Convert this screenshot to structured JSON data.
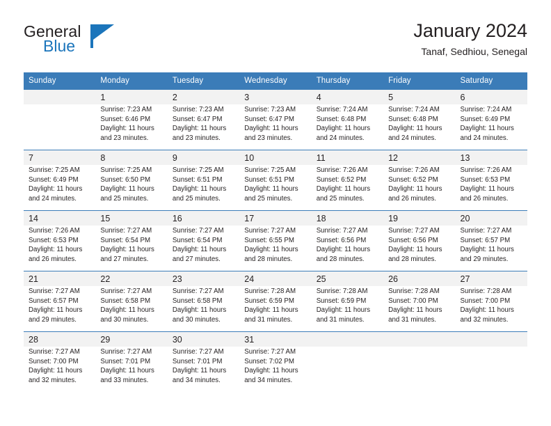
{
  "brand": {
    "name_part1": "General",
    "name_part2": "Blue",
    "flag_icon": "blue-flag-icon",
    "accent_color": "#1b75bb"
  },
  "header": {
    "title": "January 2024",
    "subtitle": "Tanaf, Sedhiou, Senegal"
  },
  "calendar": {
    "header_bg": "#3b7cb8",
    "daynum_bg": "#f2f2f2",
    "weekdays": [
      "Sunday",
      "Monday",
      "Tuesday",
      "Wednesday",
      "Thursday",
      "Friday",
      "Saturday"
    ],
    "weeks": [
      [
        {
          "day": "",
          "sunrise": "",
          "sunset": "",
          "daylight_1": "",
          "daylight_2": ""
        },
        {
          "day": "1",
          "sunrise": "Sunrise: 7:23 AM",
          "sunset": "Sunset: 6:46 PM",
          "daylight_1": "Daylight: 11 hours",
          "daylight_2": "and 23 minutes."
        },
        {
          "day": "2",
          "sunrise": "Sunrise: 7:23 AM",
          "sunset": "Sunset: 6:47 PM",
          "daylight_1": "Daylight: 11 hours",
          "daylight_2": "and 23 minutes."
        },
        {
          "day": "3",
          "sunrise": "Sunrise: 7:23 AM",
          "sunset": "Sunset: 6:47 PM",
          "daylight_1": "Daylight: 11 hours",
          "daylight_2": "and 23 minutes."
        },
        {
          "day": "4",
          "sunrise": "Sunrise: 7:24 AM",
          "sunset": "Sunset: 6:48 PM",
          "daylight_1": "Daylight: 11 hours",
          "daylight_2": "and 24 minutes."
        },
        {
          "day": "5",
          "sunrise": "Sunrise: 7:24 AM",
          "sunset": "Sunset: 6:48 PM",
          "daylight_1": "Daylight: 11 hours",
          "daylight_2": "and 24 minutes."
        },
        {
          "day": "6",
          "sunrise": "Sunrise: 7:24 AM",
          "sunset": "Sunset: 6:49 PM",
          "daylight_1": "Daylight: 11 hours",
          "daylight_2": "and 24 minutes."
        }
      ],
      [
        {
          "day": "7",
          "sunrise": "Sunrise: 7:25 AM",
          "sunset": "Sunset: 6:49 PM",
          "daylight_1": "Daylight: 11 hours",
          "daylight_2": "and 24 minutes."
        },
        {
          "day": "8",
          "sunrise": "Sunrise: 7:25 AM",
          "sunset": "Sunset: 6:50 PM",
          "daylight_1": "Daylight: 11 hours",
          "daylight_2": "and 25 minutes."
        },
        {
          "day": "9",
          "sunrise": "Sunrise: 7:25 AM",
          "sunset": "Sunset: 6:51 PM",
          "daylight_1": "Daylight: 11 hours",
          "daylight_2": "and 25 minutes."
        },
        {
          "day": "10",
          "sunrise": "Sunrise: 7:25 AM",
          "sunset": "Sunset: 6:51 PM",
          "daylight_1": "Daylight: 11 hours",
          "daylight_2": "and 25 minutes."
        },
        {
          "day": "11",
          "sunrise": "Sunrise: 7:26 AM",
          "sunset": "Sunset: 6:52 PM",
          "daylight_1": "Daylight: 11 hours",
          "daylight_2": "and 25 minutes."
        },
        {
          "day": "12",
          "sunrise": "Sunrise: 7:26 AM",
          "sunset": "Sunset: 6:52 PM",
          "daylight_1": "Daylight: 11 hours",
          "daylight_2": "and 26 minutes."
        },
        {
          "day": "13",
          "sunrise": "Sunrise: 7:26 AM",
          "sunset": "Sunset: 6:53 PM",
          "daylight_1": "Daylight: 11 hours",
          "daylight_2": "and 26 minutes."
        }
      ],
      [
        {
          "day": "14",
          "sunrise": "Sunrise: 7:26 AM",
          "sunset": "Sunset: 6:53 PM",
          "daylight_1": "Daylight: 11 hours",
          "daylight_2": "and 26 minutes."
        },
        {
          "day": "15",
          "sunrise": "Sunrise: 7:27 AM",
          "sunset": "Sunset: 6:54 PM",
          "daylight_1": "Daylight: 11 hours",
          "daylight_2": "and 27 minutes."
        },
        {
          "day": "16",
          "sunrise": "Sunrise: 7:27 AM",
          "sunset": "Sunset: 6:54 PM",
          "daylight_1": "Daylight: 11 hours",
          "daylight_2": "and 27 minutes."
        },
        {
          "day": "17",
          "sunrise": "Sunrise: 7:27 AM",
          "sunset": "Sunset: 6:55 PM",
          "daylight_1": "Daylight: 11 hours",
          "daylight_2": "and 28 minutes."
        },
        {
          "day": "18",
          "sunrise": "Sunrise: 7:27 AM",
          "sunset": "Sunset: 6:56 PM",
          "daylight_1": "Daylight: 11 hours",
          "daylight_2": "and 28 minutes."
        },
        {
          "day": "19",
          "sunrise": "Sunrise: 7:27 AM",
          "sunset": "Sunset: 6:56 PM",
          "daylight_1": "Daylight: 11 hours",
          "daylight_2": "and 28 minutes."
        },
        {
          "day": "20",
          "sunrise": "Sunrise: 7:27 AM",
          "sunset": "Sunset: 6:57 PM",
          "daylight_1": "Daylight: 11 hours",
          "daylight_2": "and 29 minutes."
        }
      ],
      [
        {
          "day": "21",
          "sunrise": "Sunrise: 7:27 AM",
          "sunset": "Sunset: 6:57 PM",
          "daylight_1": "Daylight: 11 hours",
          "daylight_2": "and 29 minutes."
        },
        {
          "day": "22",
          "sunrise": "Sunrise: 7:27 AM",
          "sunset": "Sunset: 6:58 PM",
          "daylight_1": "Daylight: 11 hours",
          "daylight_2": "and 30 minutes."
        },
        {
          "day": "23",
          "sunrise": "Sunrise: 7:27 AM",
          "sunset": "Sunset: 6:58 PM",
          "daylight_1": "Daylight: 11 hours",
          "daylight_2": "and 30 minutes."
        },
        {
          "day": "24",
          "sunrise": "Sunrise: 7:28 AM",
          "sunset": "Sunset: 6:59 PM",
          "daylight_1": "Daylight: 11 hours",
          "daylight_2": "and 31 minutes."
        },
        {
          "day": "25",
          "sunrise": "Sunrise: 7:28 AM",
          "sunset": "Sunset: 6:59 PM",
          "daylight_1": "Daylight: 11 hours",
          "daylight_2": "and 31 minutes."
        },
        {
          "day": "26",
          "sunrise": "Sunrise: 7:28 AM",
          "sunset": "Sunset: 7:00 PM",
          "daylight_1": "Daylight: 11 hours",
          "daylight_2": "and 31 minutes."
        },
        {
          "day": "27",
          "sunrise": "Sunrise: 7:28 AM",
          "sunset": "Sunset: 7:00 PM",
          "daylight_1": "Daylight: 11 hours",
          "daylight_2": "and 32 minutes."
        }
      ],
      [
        {
          "day": "28",
          "sunrise": "Sunrise: 7:27 AM",
          "sunset": "Sunset: 7:00 PM",
          "daylight_1": "Daylight: 11 hours",
          "daylight_2": "and 32 minutes."
        },
        {
          "day": "29",
          "sunrise": "Sunrise: 7:27 AM",
          "sunset": "Sunset: 7:01 PM",
          "daylight_1": "Daylight: 11 hours",
          "daylight_2": "and 33 minutes."
        },
        {
          "day": "30",
          "sunrise": "Sunrise: 7:27 AM",
          "sunset": "Sunset: 7:01 PM",
          "daylight_1": "Daylight: 11 hours",
          "daylight_2": "and 34 minutes."
        },
        {
          "day": "31",
          "sunrise": "Sunrise: 7:27 AM",
          "sunset": "Sunset: 7:02 PM",
          "daylight_1": "Daylight: 11 hours",
          "daylight_2": "and 34 minutes."
        },
        {
          "day": "",
          "sunrise": "",
          "sunset": "",
          "daylight_1": "",
          "daylight_2": ""
        },
        {
          "day": "",
          "sunrise": "",
          "sunset": "",
          "daylight_1": "",
          "daylight_2": ""
        },
        {
          "day": "",
          "sunrise": "",
          "sunset": "",
          "daylight_1": "",
          "daylight_2": ""
        }
      ]
    ]
  }
}
